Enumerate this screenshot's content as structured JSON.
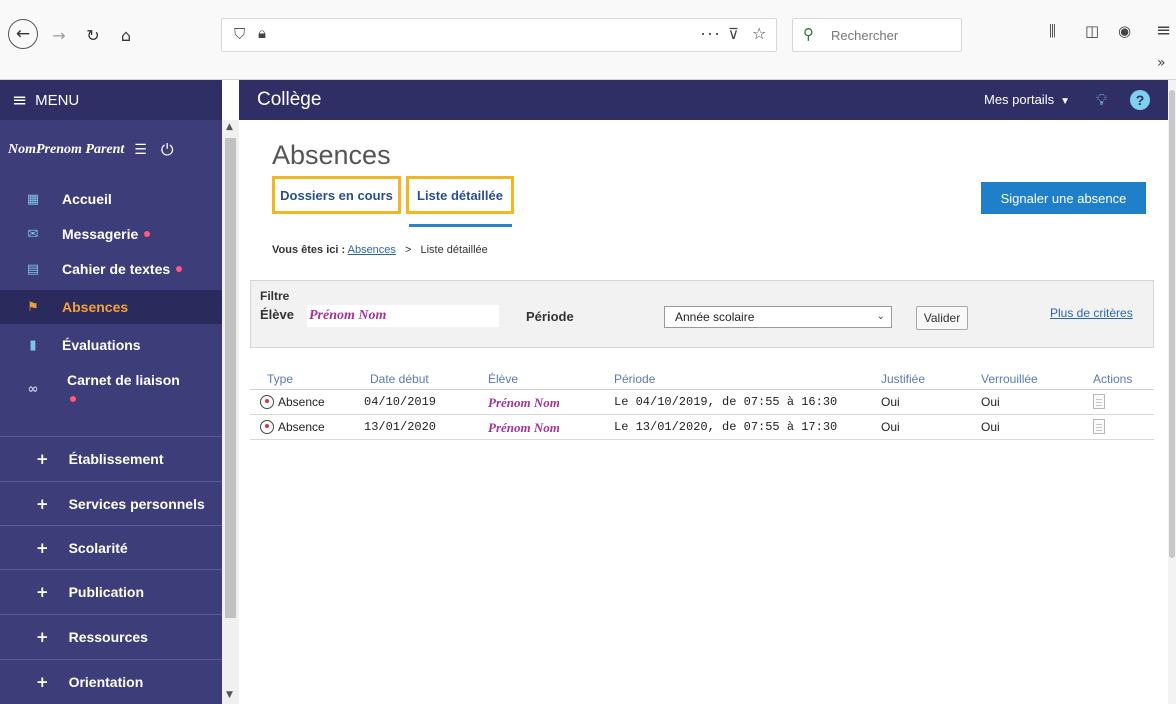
{
  "browser": {
    "search_placeholder": "Rechercher",
    "more_icon_glyph": "···"
  },
  "sidebar": {
    "menu_label": "MENU",
    "user_name": "NomPrenom Parent",
    "items": [
      {
        "label": "Accueil",
        "icon": "grid-icon",
        "dot": false
      },
      {
        "label": "Messagerie",
        "icon": "envelope-icon",
        "dot": true
      },
      {
        "label": "Cahier de textes",
        "icon": "book-icon",
        "dot": true
      },
      {
        "label": "Absences",
        "icon": "person-walking-icon",
        "dot": false,
        "active": true
      },
      {
        "label": "Évaluations",
        "icon": "bar-chart-icon",
        "dot": false
      },
      {
        "label": "Carnet de liaison",
        "icon": "link-icon",
        "dot": true
      }
    ],
    "sections": [
      {
        "label": "Établissement"
      },
      {
        "label": "Services personnels"
      },
      {
        "label": "Scolarité"
      },
      {
        "label": "Publication"
      },
      {
        "label": "Ressources"
      },
      {
        "label": "Orientation"
      }
    ]
  },
  "header": {
    "title": "Collège",
    "portals_label": "Mes portails",
    "help_label": "?"
  },
  "main": {
    "page_title": "Absences",
    "tabs": [
      {
        "label": "Dossiers en cours"
      },
      {
        "label": "Liste détaillée",
        "active": true
      }
    ],
    "report_button": "Signaler une absence",
    "breadcrumb": {
      "prefix": "Vous êtes ici :",
      "link": "Absences",
      "separator": ">",
      "current": "Liste détaillée"
    },
    "filter": {
      "legend": "Filtre",
      "eleve_label": "Élève",
      "eleve_value": "Prénom Nom",
      "periode_label": "Période",
      "periode_value": "Année scolaire",
      "validate_label": "Valider",
      "more_criteria": "Plus de critères"
    },
    "table": {
      "headers": [
        "Type",
        "Date début",
        "Élève",
        "Période",
        "Justifiée",
        "Verrouillée",
        "Actions"
      ],
      "rows": [
        {
          "type": "Absence",
          "date": "04/10/2019",
          "eleve": "Prénom Nom",
          "periode": "Le 04/10/2019, de 07:55 à 16:30",
          "justifiee": "Oui",
          "verrouillee": "Oui"
        },
        {
          "type": "Absence",
          "date": "13/01/2020",
          "eleve": "Prénom Nom",
          "periode": "Le 13/01/2020, de 07:55 à 17:30",
          "justifiee": "Oui",
          "verrouillee": "Oui"
        }
      ]
    }
  },
  "colors": {
    "sidebar_bg": "#3d3d7a",
    "header_bg": "#2f2f66",
    "accent_blue": "#1f7fc8",
    "highlight_yellow": "#f2b823",
    "student_name": "#a6339b",
    "active_item": "#f0a33a"
  }
}
